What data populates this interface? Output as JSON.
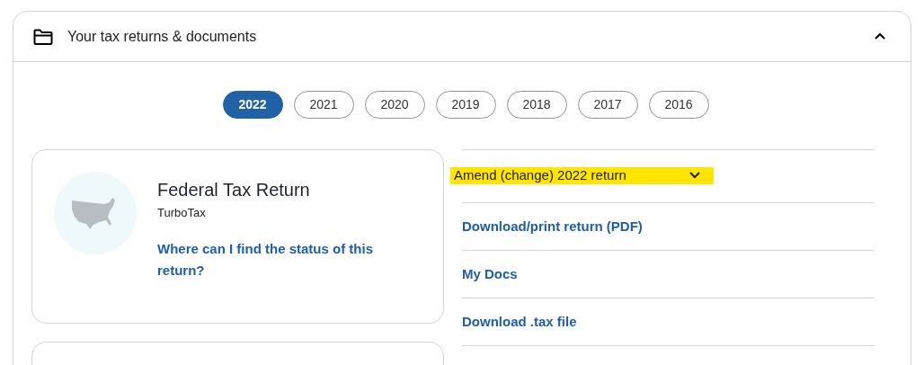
{
  "section": {
    "title": "Your tax returns & documents",
    "expanded": true
  },
  "years": [
    {
      "label": "2022",
      "selected": true
    },
    {
      "label": "2021",
      "selected": false
    },
    {
      "label": "2020",
      "selected": false
    },
    {
      "label": "2019",
      "selected": false
    },
    {
      "label": "2018",
      "selected": false
    },
    {
      "label": "2017",
      "selected": false
    },
    {
      "label": "2016",
      "selected": false
    }
  ],
  "return_card": {
    "title": "Federal Tax Return",
    "subtitle": "TurboTax",
    "link": "Where can I find the status of this return?"
  },
  "actions": [
    {
      "kind": "dropdown",
      "label": "Amend (change) 2022 return",
      "highlighted": true
    },
    {
      "kind": "link",
      "label": "Download/print return (PDF)",
      "highlighted": false
    },
    {
      "kind": "link",
      "label": "My Docs",
      "highlighted": false
    },
    {
      "kind": "link",
      "label": "Download .tax file",
      "highlighted": false
    }
  ]
}
